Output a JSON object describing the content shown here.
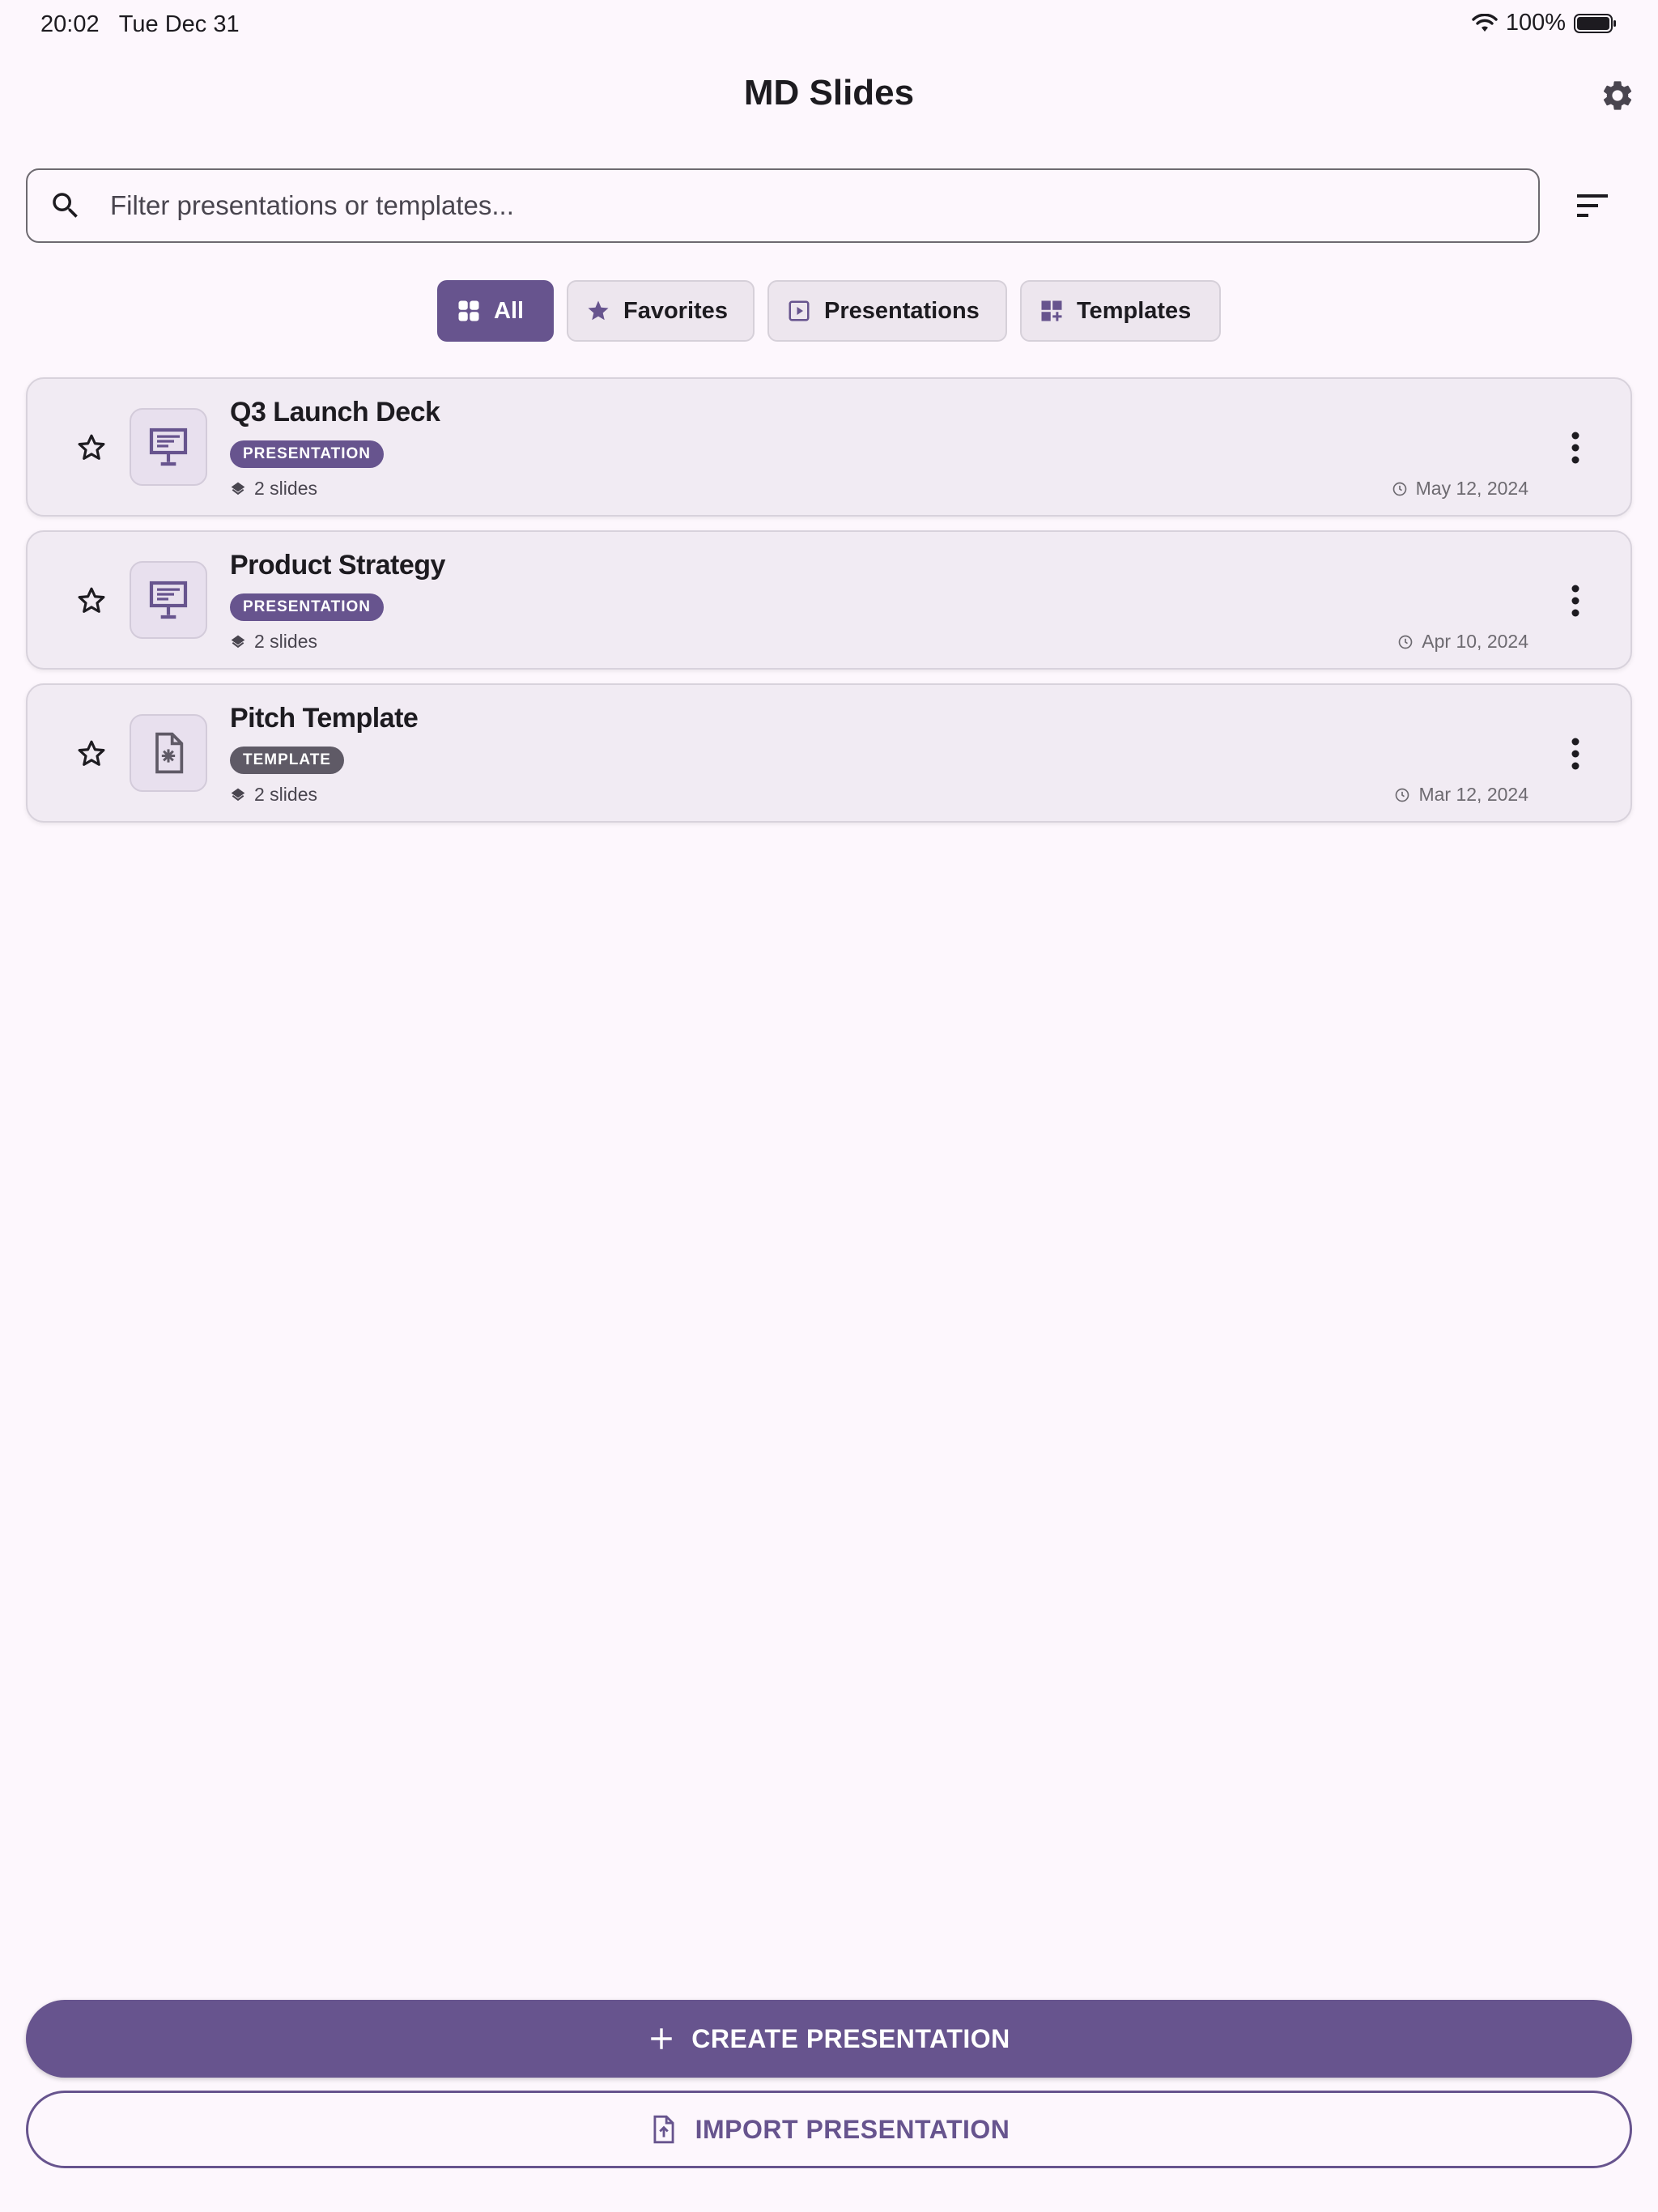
{
  "status_bar": {
    "time": "20:02",
    "date": "Tue Dec 31",
    "battery": "100%"
  },
  "header": {
    "title": "MD Slides"
  },
  "search": {
    "placeholder": "Filter presentations or templates..."
  },
  "filters": [
    {
      "label": "All",
      "active": true
    },
    {
      "label": "Favorites",
      "active": false
    },
    {
      "label": "Presentations",
      "active": false
    },
    {
      "label": "Templates",
      "active": false
    }
  ],
  "items": [
    {
      "name": "Q3 Launch Deck",
      "type": "PRESENTATION",
      "slides": "2 slides",
      "date": "May 12, 2024",
      "icon": "presentation-board-icon"
    },
    {
      "name": "Product Strategy",
      "type": "PRESENTATION",
      "slides": "2 slides",
      "date": "Apr 10, 2024",
      "icon": "presentation-board-icon"
    },
    {
      "name": "Pitch Template",
      "type": "TEMPLATE",
      "slides": "2 slides",
      "date": "Mar 12, 2024",
      "icon": "template-file-icon"
    }
  ],
  "actions": {
    "create": "CREATE PRESENTATION",
    "import": "IMPORT PRESENTATION"
  },
  "colors": {
    "primary": "#67548e",
    "background": "#fdf7fd",
    "card": "#f1ebf3"
  }
}
